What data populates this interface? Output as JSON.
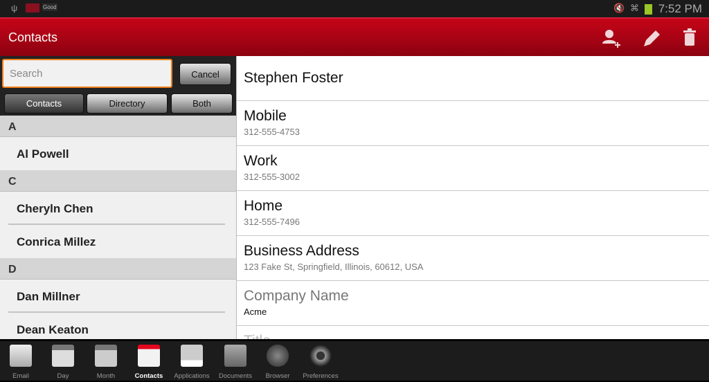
{
  "status_bar": {
    "time": "7:52 PM",
    "notification_badge": "Good",
    "icons": [
      "usb-icon",
      "app-notification-icon",
      "mute-icon",
      "wifi-icon",
      "battery-icon"
    ]
  },
  "header": {
    "title": "Contacts",
    "actions": [
      "add-contact",
      "edit",
      "delete"
    ]
  },
  "search": {
    "placeholder": "Search",
    "value": "",
    "cancel_label": "Cancel"
  },
  "filters": [
    {
      "label": "Contacts",
      "active": true
    },
    {
      "label": "Directory",
      "active": false
    },
    {
      "label": "Both",
      "active": false
    }
  ],
  "contacts": [
    {
      "section": "A",
      "names": [
        "Al  Powell"
      ]
    },
    {
      "section": "C",
      "names": [
        "Cheryln  Chen",
        "Conrica  Millez"
      ]
    },
    {
      "section": "D",
      "names": [
        "Dan  Millner",
        "Dean  Keaton"
      ]
    }
  ],
  "detail": {
    "name": "Stephen Foster",
    "fields": [
      {
        "label": "Mobile",
        "value": "312-555-4753"
      },
      {
        "label": "Work",
        "value": "312-555-3002"
      },
      {
        "label": "Home",
        "value": "312-555-7496"
      },
      {
        "label": "Business Address",
        "value": "123 Fake St, Springfield, Illinois, 60612, USA"
      },
      {
        "label": "Company Name",
        "value": "Acme"
      },
      {
        "label": "Title",
        "value": ""
      }
    ]
  },
  "nav": [
    {
      "label": "Email",
      "icon": "email-icon"
    },
    {
      "label": "Day",
      "icon": "day-calendar-icon"
    },
    {
      "label": "Month",
      "icon": "month-calendar-icon"
    },
    {
      "label": "Contacts",
      "icon": "contacts-card-icon",
      "active": true
    },
    {
      "label": "Applications",
      "icon": "shopping-bag-icon"
    },
    {
      "label": "Documents",
      "icon": "folder-icon"
    },
    {
      "label": "Browser",
      "icon": "globe-icon"
    },
    {
      "label": "Preferences",
      "icon": "gears-icon"
    }
  ],
  "colors": {
    "accent": "#c50418",
    "search_focus": "#f07e1a"
  }
}
